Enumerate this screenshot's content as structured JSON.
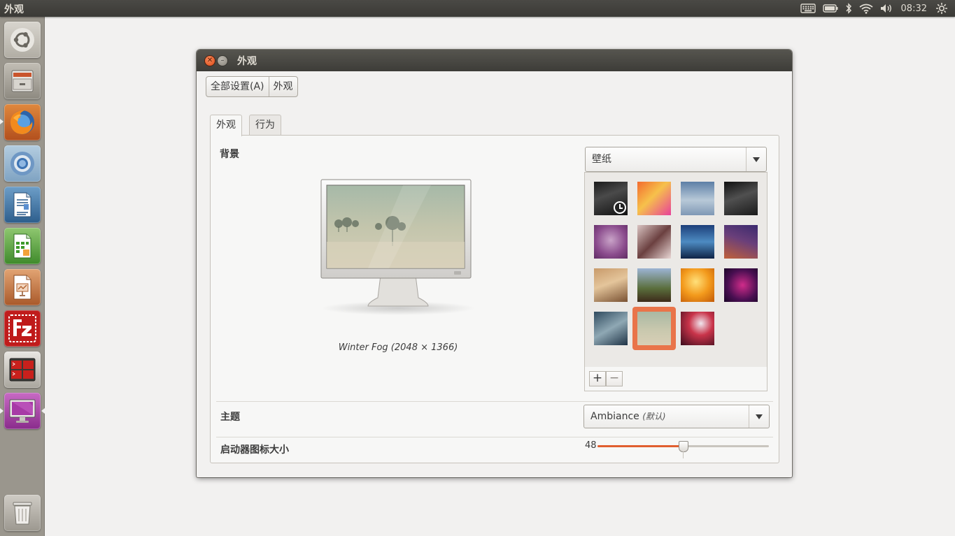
{
  "top_panel": {
    "app_title": "外观",
    "clock": "08:32",
    "indicators": [
      "keyboard-icon",
      "battery-icon",
      "bluetooth-icon",
      "wifi-icon",
      "volume-icon",
      "gear-icon"
    ]
  },
  "launcher": {
    "items": [
      {
        "name": "dash-home",
        "icon": "ubuntu-logo-icon"
      },
      {
        "name": "files",
        "icon": "file-cabinet-icon"
      },
      {
        "name": "firefox",
        "icon": "firefox-icon",
        "running": true
      },
      {
        "name": "chromium",
        "icon": "chromium-icon"
      },
      {
        "name": "writer",
        "icon": "writer-document-icon"
      },
      {
        "name": "calc",
        "icon": "calc-spreadsheet-icon"
      },
      {
        "name": "impress",
        "icon": "impress-presentation-icon"
      },
      {
        "name": "filezilla",
        "icon": "filezilla-icon"
      },
      {
        "name": "terminal",
        "icon": "terminal-icon"
      },
      {
        "name": "appearance-settings",
        "icon": "display-settings-icon",
        "active": true
      },
      {
        "name": "trash",
        "icon": "trash-icon"
      }
    ]
  },
  "window": {
    "title": "外观",
    "breadcrumb": [
      "全部设置(A)",
      "外观"
    ],
    "tabs": [
      {
        "label": "外观",
        "active": true
      },
      {
        "label": "行为",
        "active": false
      }
    ],
    "background": {
      "label": "背景",
      "source_combo": "壁纸",
      "caption": "Winter Fog (2048 × 1366)",
      "selected_index": 13,
      "add_label": "+",
      "remove_label": "−"
    },
    "theme": {
      "label": "主题",
      "value": "Ambiance",
      "suffix": "(默认)"
    },
    "launcher_size": {
      "label": "启动器图标大小",
      "value": "48",
      "fraction": 0.5
    }
  },
  "colors": {
    "accent": "#e05e2f",
    "panel": "#3c3b37",
    "launcher": "#9a968d",
    "window_bg": "#f2f1f0"
  }
}
